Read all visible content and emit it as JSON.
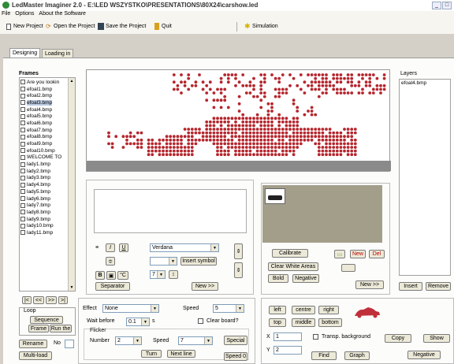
{
  "window": {
    "title": "LedMaster Imaginer 2.0 - E:\\LED WSZYSTKO\\PRESENTATIONS\\80X24\\carshow.led"
  },
  "menu": [
    "File",
    "Options",
    "About the Software"
  ],
  "toolbar": {
    "new_project": "New Project",
    "open_project": "Open the Project",
    "save_project": "Save the Project",
    "quit": "Quit",
    "simulation": "Simulation"
  },
  "tabs": [
    "Designing",
    "Loading in"
  ],
  "frames": {
    "title": "Frames",
    "items": [
      "Are you lookin",
      "efoal1.bmp",
      "efoal2.bmp",
      "efoal3.bmp",
      "efoal4.bmp",
      "efoal5.bmp",
      "efoal6.bmp",
      "efoal7.bmp",
      "efoal8.bmp",
      "efoal9.bmp",
      "efoal10.bmp",
      "WELCOME TO",
      "lady1.bmp",
      "lady2.bmp",
      "lady3.bmp",
      "lady4.bmp",
      "lady5.bmp",
      "lady6.bmp",
      "lady7.bmp",
      "lady8.bmp",
      "lady9.bmp",
      "lady10.bmp",
      "lady11.bmp"
    ],
    "selected_index": 3,
    "nav": [
      "|<",
      "<<",
      ">>",
      ">|"
    ],
    "loop_label": "Loop",
    "sequence_label": "Sequence",
    "frame_btn": "Frame",
    "run_btn": "Run the",
    "rename_btn": "Rename",
    "no_label": "No",
    "multi_btn": "Multi-load"
  },
  "layers": {
    "title": "Layers",
    "items": [
      "efoal4.bmp"
    ],
    "insert": "Insert",
    "remove": "Remove"
  },
  "text_tools": {
    "font": "Verdana",
    "insert_symbol": "Insert symbol",
    "separator": "Separator",
    "new": "New >>",
    "bold": "B",
    "italic": "I",
    "underline": "U",
    "size": "7"
  },
  "image_tools": {
    "calibrate": "Calibrate",
    "clear_white": "Clear White Areas",
    "bold": "Bold",
    "negative": "Negative",
    "new": "New",
    "del": "Del",
    "new_next": "New >>"
  },
  "effects": {
    "effect_label": "Effect",
    "effect_value": "None",
    "speed_label": "Speed",
    "speed_value": "5",
    "wait_label": "Wait before",
    "wait_value": "0.1",
    "wait_unit": "s",
    "clear_board": "Clear board?",
    "flicker_label": "Flicker",
    "number_label": "Number",
    "number_value": "2",
    "speed2_label": "Speed",
    "speed2_value": "7",
    "special": "Special",
    "turn": "Turn",
    "next_line": "Next line",
    "speed0": "Speed 0"
  },
  "position": {
    "left": "left",
    "centre": "centre",
    "right": "right",
    "top": "top",
    "middle": "middle",
    "bottom": "bottom",
    "x_label": "X",
    "x_value": "1",
    "y_label": "Y",
    "y_value": "2",
    "transp": "Transp. background",
    "copy": "Copy",
    "show": "Show",
    "find": "Find",
    "graph": "Graph",
    "negative": "Negative"
  },
  "colors": {
    "led": "#b5262d",
    "accent": "#0a246a"
  }
}
